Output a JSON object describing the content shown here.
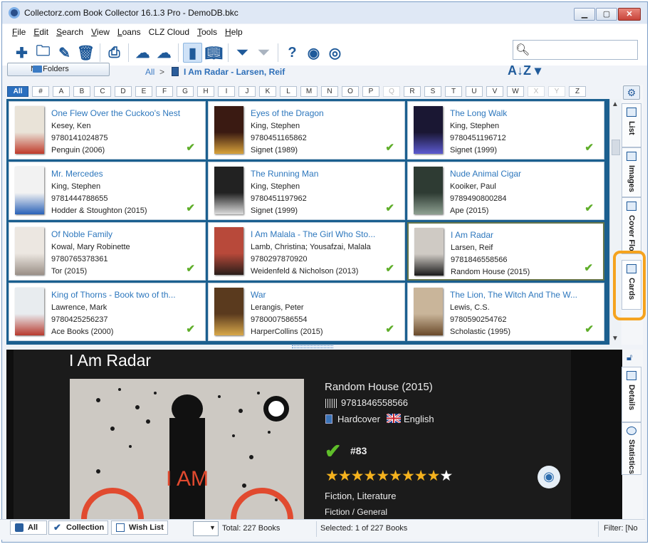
{
  "window": {
    "title": "Collectorz.com Book Collector 16.1.3 Pro - DemoDB.bkc",
    "min": "▁",
    "max": "▢",
    "close": "✕"
  },
  "menu": [
    {
      "label": "File",
      "key": "F",
      "rest": "ile"
    },
    {
      "label": "Edit",
      "key": "E",
      "rest": "dit"
    },
    {
      "label": "Search",
      "key": "S",
      "rest": "earch"
    },
    {
      "label": "View",
      "key": "V",
      "rest": "iew"
    },
    {
      "label": "Loans",
      "key": "L",
      "rest": "oans"
    },
    {
      "label": "CLZ Cloud",
      "key": "",
      "rest": "CLZ Cloud"
    },
    {
      "label": "Tools",
      "key": "T",
      "rest": "ools"
    },
    {
      "label": "Help",
      "key": "H",
      "rest": "elp"
    }
  ],
  "toolbar": {
    "buttons": [
      "add-icon",
      "add-folder-icon",
      "edit-icon",
      "delete-icon",
      "sep",
      "print-icon",
      "sep",
      "cloud-down-icon",
      "cloud-up-icon",
      "sep",
      "book-view-icon",
      "open-book-icon",
      "sep",
      "filter-icon",
      "filter-clear-icon",
      "sep",
      "help-icon",
      "search-web-icon",
      "webcam-icon"
    ],
    "search_value": ""
  },
  "nav": {
    "folders_label": "No Folders",
    "crumb_all": "All",
    "crumb_sep": ">",
    "crumb_title": "I Am Radar - Larsen, Reif"
  },
  "alphabet": [
    "All",
    "#",
    "A",
    "B",
    "C",
    "D",
    "E",
    "F",
    "G",
    "H",
    "I",
    "J",
    "K",
    "L",
    "M",
    "N",
    "O",
    "P",
    "Q",
    "R",
    "S",
    "T",
    "U",
    "V",
    "W",
    "X",
    "Y",
    "Z"
  ],
  "alphabet_disabled": [
    "Q",
    "X",
    "Y"
  ],
  "books": [
    {
      "title": "One Flew Over the Cuckoo's Nest",
      "author": "Kesey, Ken",
      "isbn": "9780141024875",
      "publisher": "Penguin (2006)",
      "cover": "#e9e3d8",
      "accent": "#c03a2a"
    },
    {
      "title": "Eyes of the Dragon",
      "author": "King, Stephen",
      "isbn": "9780451165862",
      "publisher": "Signet (1989)",
      "cover": "#3a1a12",
      "accent": "#d8a23a"
    },
    {
      "title": "The Long Walk",
      "author": "King, Stephen",
      "isbn": "9780451196712",
      "publisher": "Signet (1999)",
      "cover": "#1a1733",
      "accent": "#5c5ad0"
    },
    {
      "title": "Mr. Mercedes",
      "author": "King, Stephen",
      "isbn": "9781444788655",
      "publisher": "Hodder & Stoughton (2015)",
      "cover": "#f2f2f2",
      "accent": "#2a62b8"
    },
    {
      "title": "The Running Man",
      "author": "King, Stephen",
      "isbn": "9780451197962",
      "publisher": "Signet (1999)",
      "cover": "#222",
      "accent": "#ddd"
    },
    {
      "title": "Nude Animal Cigar",
      "author": "Kooiker, Paul",
      "isbn": "9789490800284",
      "publisher": "Ape (2015)",
      "cover": "#2e3b33",
      "accent": "#8ea091"
    },
    {
      "title": "Of Noble Family",
      "author": "Kowal, Mary Robinette",
      "isbn": "9780765378361",
      "publisher": "Tor (2015)",
      "cover": "#ece7e1",
      "accent": "#9a8f86"
    },
    {
      "title": "I Am Malala - The Girl Who Sto...",
      "author": "Lamb, Christina; Yousafzai, Malala",
      "isbn": "9780297870920",
      "publisher": "Weidenfeld & Nicholson (2013)",
      "cover": "#b8493a",
      "accent": "#2a1e1a"
    },
    {
      "title": "I Am Radar",
      "author": "Larsen, Reif",
      "isbn": "9781846558566",
      "publisher": "Random House (2015)",
      "cover": "#cfcac4",
      "accent": "#1a1a1a",
      "selected": true
    },
    {
      "title": "King of Thorns - Book two of th...",
      "author": "Lawrence, Mark",
      "isbn": "9780425256237",
      "publisher": "Ace Books (2000)",
      "cover": "#e8ecef",
      "accent": "#b83a2e"
    },
    {
      "title": "War",
      "author": "Lerangis, Peter",
      "isbn": "9780007586554",
      "publisher": "HarperCollins (2015)",
      "cover": "#5a3a1e",
      "accent": "#d8a84a"
    },
    {
      "title": "The Lion, The Witch And The W...",
      "author": "Lewis, C.S.",
      "isbn": "9780590254762",
      "publisher": "Scholastic (1995)",
      "cover": "#c9b59a",
      "accent": "#6a4a2a"
    }
  ],
  "view_tabs": {
    "list": "List",
    "images": "Images",
    "cover_flow": "Cover Flo",
    "cards": "Cards"
  },
  "detail": {
    "title": "I Am Radar",
    "publisher": "Random House (2015)",
    "isbn": "9781846558566",
    "format": "Hardcover",
    "language": "English",
    "index": "#83",
    "rating": 9,
    "rating_max": 10,
    "genre": "Fiction, Literature",
    "subject": "Fiction / General",
    "cover_text": "I AM",
    "tabs": {
      "details": "Details",
      "statistics": "Statistics"
    }
  },
  "statusbar": {
    "tabs": [
      "All",
      "Collection",
      "Wish List"
    ],
    "total": "Total: 227 Books",
    "selected": "Selected: 1 of 227 Books",
    "filter": "Filter: [No"
  }
}
